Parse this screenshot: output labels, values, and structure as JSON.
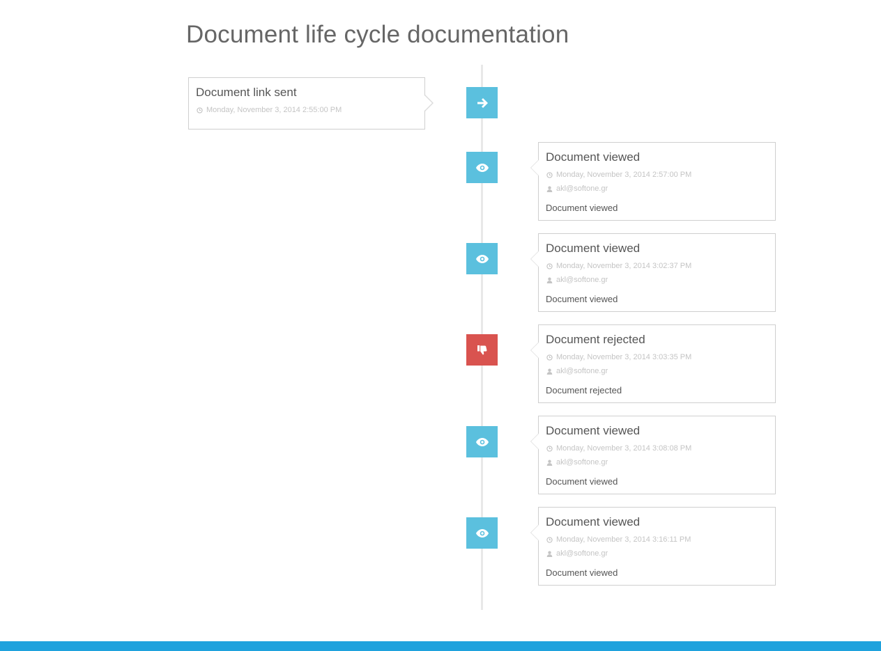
{
  "page": {
    "title": "Document life cycle documentation"
  },
  "colors": {
    "marker_info": "#5bc0de",
    "marker_danger": "#d9534f",
    "footer": "#1fa2dd"
  },
  "events": [
    {
      "title": "Document link sent",
      "timestamp": "Monday, November 3, 2014 2:55:00 PM",
      "icon": "arrow-right-icon",
      "status": "info"
    },
    {
      "title": "Document viewed",
      "timestamp": "Monday, November 3, 2014 2:57:00 PM",
      "user": "akl@softone.gr",
      "description": "Document viewed",
      "icon": "eye-icon",
      "status": "info"
    },
    {
      "title": "Document viewed",
      "timestamp": "Monday, November 3, 2014 3:02:37 PM",
      "user": "akl@softone.gr",
      "description": "Document viewed",
      "icon": "eye-icon",
      "status": "info"
    },
    {
      "title": "Document rejected",
      "timestamp": "Monday, November 3, 2014 3:03:35 PM",
      "user": "akl@softone.gr",
      "description": "Document rejected",
      "icon": "thumbs-down-icon",
      "status": "danger"
    },
    {
      "title": "Document viewed",
      "timestamp": "Monday, November 3, 2014 3:08:08 PM",
      "user": "akl@softone.gr",
      "description": "Document viewed",
      "icon": "eye-icon",
      "status": "info"
    },
    {
      "title": "Document viewed",
      "timestamp": "Monday, November 3, 2014 3:16:11 PM",
      "user": "akl@softone.gr",
      "description": "Document viewed",
      "icon": "eye-icon",
      "status": "info"
    }
  ]
}
